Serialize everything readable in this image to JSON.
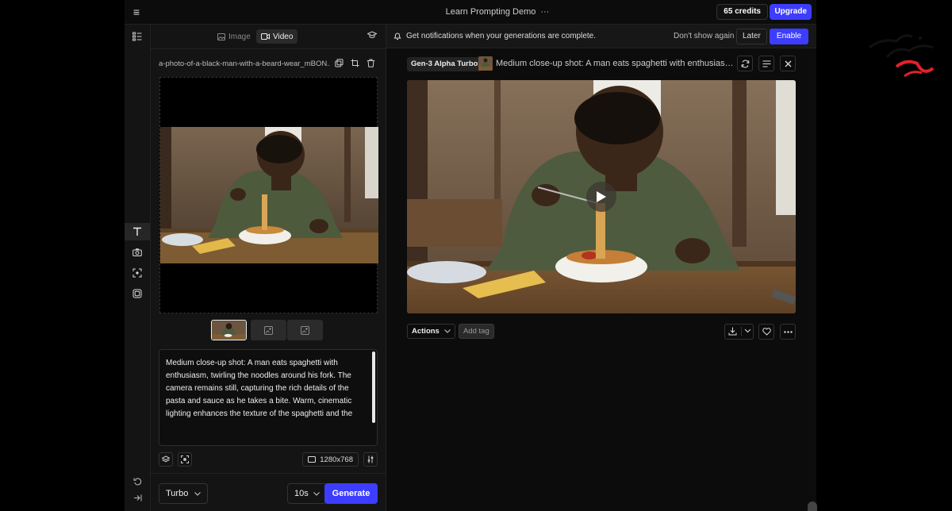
{
  "topbar": {
    "title": "Learn Prompting Demo",
    "more": "···",
    "credits": "65 credits",
    "upgrade": "Upgrade"
  },
  "mode_tabs": {
    "image": "Image",
    "video": "Video"
  },
  "file": {
    "name": "a-photo-of-a-black-man-with-a-beard-wear_mBON..."
  },
  "prompt": {
    "text": "Medium close-up shot: A man eats spaghetti with enthusiasm, twirling the noodles around his fork. The camera remains still, capturing the rich details of the pasta and sauce as he takes a bite. Warm, cinematic lighting enhances the texture of the spaghetti and the"
  },
  "options": {
    "resolution": "1280x768"
  },
  "bottom": {
    "model": "Turbo",
    "duration": "10s",
    "generate": "Generate"
  },
  "notification": {
    "text": "Get notifications when your generations are complete.",
    "dont_show": "Don't show again",
    "later": "Later",
    "enable": "Enable"
  },
  "generation": {
    "model": "Gen-3 Alpha Turbo",
    "prompt": "Medium close-up shot: A man eats spaghetti with enthusiasm,...",
    "actions": "Actions",
    "add_tag": "Add tag"
  },
  "colors": {
    "accent": "#3d3dff",
    "background": "#0c0c0c",
    "panel": "#141414"
  }
}
